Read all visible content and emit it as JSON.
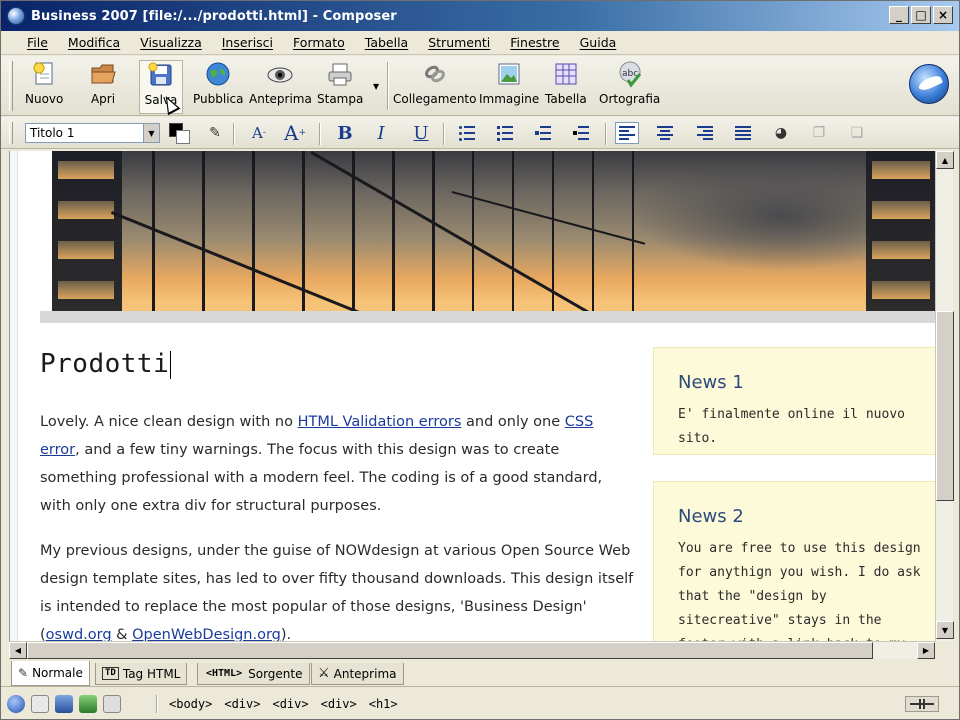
{
  "window": {
    "title": "Business 2007 [file:/.../prodotti.html] - Composer",
    "controls": [
      "_",
      "□",
      "×"
    ]
  },
  "menu": [
    "File",
    "Modifica",
    "Visualizza",
    "Inserisci",
    "Formato",
    "Tabella",
    "Strumenti",
    "Finestre",
    "Guida"
  ],
  "toolbar": {
    "buttons": [
      {
        "label": "Nuovo",
        "icon": "new-document-icon"
      },
      {
        "label": "Apri",
        "icon": "open-folder-icon"
      },
      {
        "label": "Salva",
        "icon": "save-icon"
      },
      {
        "label": "Pubblica",
        "icon": "publish-globe-icon"
      },
      {
        "label": "Anteprima",
        "icon": "preview-eye-icon"
      },
      {
        "label": "Stampa",
        "icon": "print-icon"
      },
      {
        "label": "Collegamento",
        "icon": "link-chain-icon"
      },
      {
        "label": "Immagine",
        "icon": "image-icon"
      },
      {
        "label": "Tabella",
        "icon": "table-icon"
      },
      {
        "label": "Ortografia",
        "icon": "spellcheck-icon"
      }
    ]
  },
  "format": {
    "paragraph_style": "Titolo 1",
    "buttons": [
      "B",
      "I",
      "U"
    ],
    "text_color": "#000000",
    "background_color": "#ffffff"
  },
  "document": {
    "heading": "Prodotti",
    "para1": {
      "t1": "Lovely. A nice clean design with no ",
      "link1": "HTML Validation errors",
      "t2": " and only one ",
      "link2": "CSS error",
      "t3": ", and a few tiny warnings. The focus with this design was to create something professional with a modern feel. The coding is of a good standard, with only one extra div for structural purposes."
    },
    "para2": {
      "t1": "My previous designs, under the guise of NOWdesign at various Open Source Web design template sites, has led to over fifty thousand downloads. This design itself is intended to replace the most popular of those designs, 'Business Design' (",
      "link1": "oswd.org",
      "t2": " & ",
      "link2": "OpenWebDesign.org",
      "t3": ")."
    },
    "news": [
      {
        "title": "News 1",
        "body": "E' finalmente online il nuovo sito."
      },
      {
        "title": "News 2",
        "body": "You are free to use this design for anythign you wish. I do ask that the \"design by sitecreative\" stays in the footer with a link back to my"
      }
    ],
    "link_color": "#1a3c9c",
    "news_bg": "#fdfad9"
  },
  "tabs": [
    {
      "label": "Normale",
      "badge": ""
    },
    {
      "label": "Tag HTML",
      "badge": "TD"
    },
    {
      "label": "Sorgente",
      "badge": "<HTML>"
    },
    {
      "label": "Anteprima",
      "badge": ""
    }
  ],
  "status": {
    "breadcrumb": [
      "<body>",
      "<div>",
      "<div>",
      "<div>",
      "<h1>"
    ]
  }
}
